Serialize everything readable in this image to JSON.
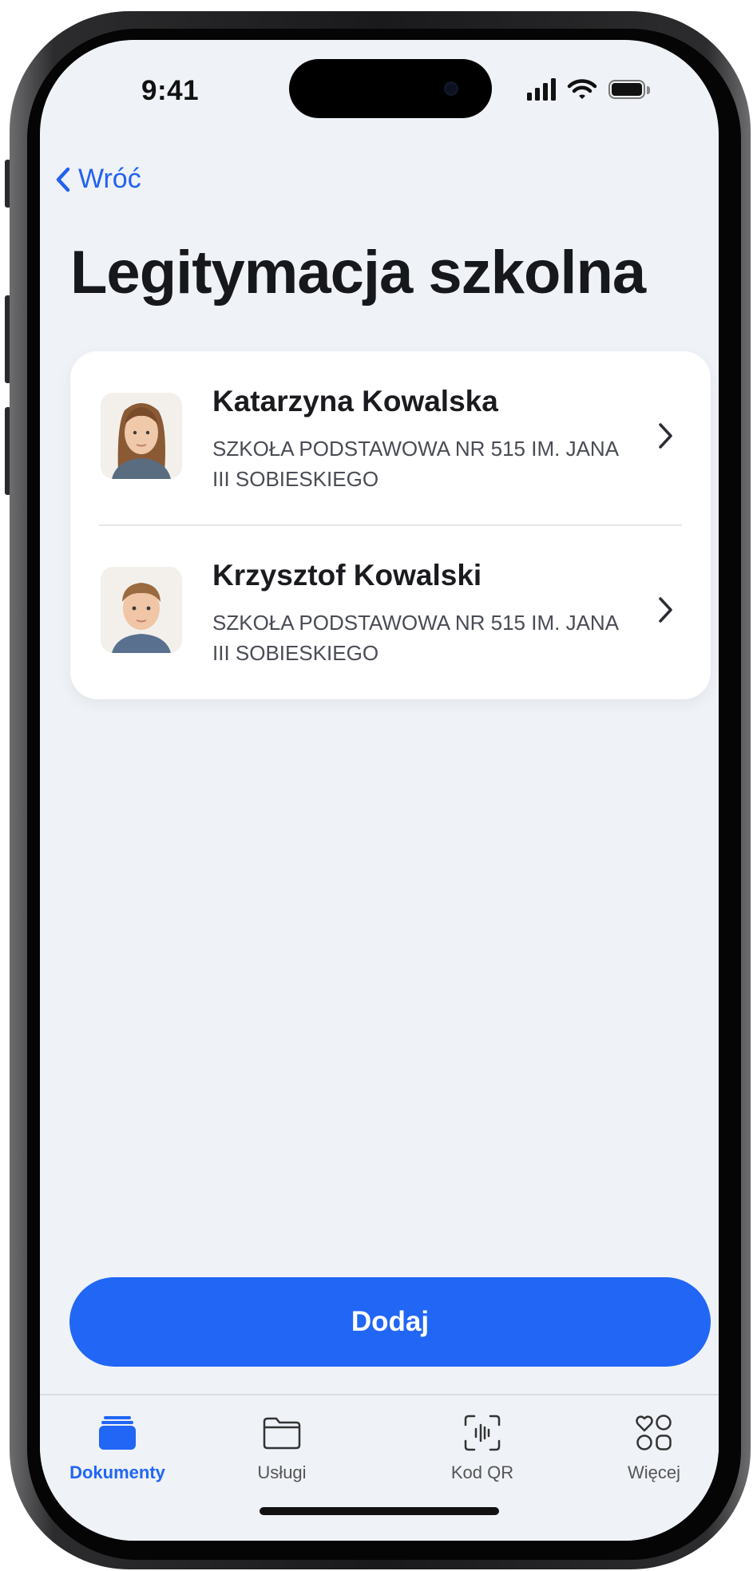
{
  "status_bar": {
    "time": "9:41"
  },
  "nav": {
    "back_label": "Wróć",
    "title": "Legitymacja szkolna"
  },
  "students": [
    {
      "name": "Katarzyna Kowalska",
      "school": "SZKOŁA PODSTAWOWA NR 515 IM. JANA III SOBIESKIEGO"
    },
    {
      "name": "Krzysztof Kowalski",
      "school": "SZKOŁA PODSTAWOWA NR 515 IM. JANA III SOBIESKIEGO"
    }
  ],
  "actions": {
    "add_label": "Dodaj"
  },
  "tabbar": {
    "active": "dokumenty",
    "items": [
      {
        "id": "dokumenty",
        "label": "Dokumenty",
        "icon": "documents-stack-icon"
      },
      {
        "id": "uslugi",
        "label": "Usługi",
        "icon": "folder-icon"
      },
      {
        "id": "kod-qr",
        "label": "Kod QR",
        "icon": "qr-scan-icon"
      },
      {
        "id": "wiecej",
        "label": "Więcej",
        "icon": "more-grid-icon"
      }
    ]
  },
  "colors": {
    "accent": "#2166f5",
    "background": "#eff2f7",
    "card": "#ffffff",
    "text": "#17181b"
  }
}
